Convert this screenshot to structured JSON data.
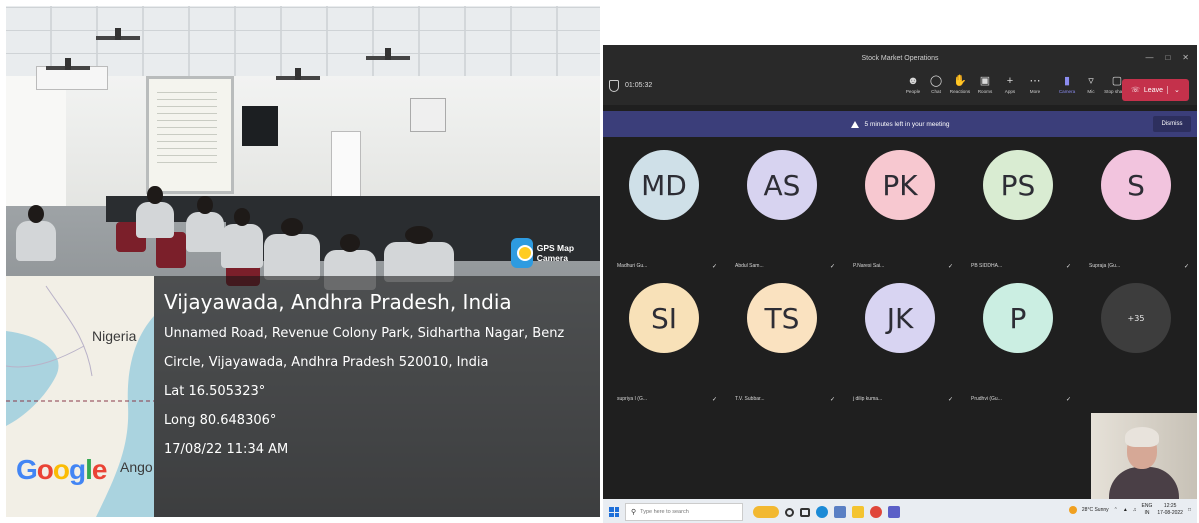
{
  "photo": {
    "gps_badge_label": "GPS Map Camera",
    "map": {
      "country_1": "Nigeria",
      "country_2": "Ango",
      "provider": "Google"
    },
    "location": {
      "city": "Vijayawada, Andhra Pradesh, India",
      "address_line_1": "Unnamed Road, Revenue Colony Park, Sidhartha Nagar, Benz",
      "address_line_2": "Circle, Vijayawada, Andhra Pradesh 520010, India",
      "lat": "Lat 16.505323°",
      "long": "Long 80.648306°",
      "timestamp": "17/08/22 11:34 AM"
    }
  },
  "teams": {
    "window_title": "Stock Market Operations",
    "timer": "01:05:32",
    "toolbar": [
      {
        "label": "People",
        "icon": "people-icon"
      },
      {
        "label": "Chat",
        "icon": "chat-icon"
      },
      {
        "label": "Reactions",
        "icon": "reactions-icon"
      },
      {
        "label": "Rooms",
        "icon": "rooms-icon"
      },
      {
        "label": "Apps",
        "icon": "apps-icon"
      },
      {
        "label": "More",
        "icon": "more-icon"
      },
      {
        "label": "Camera",
        "icon": "camera-icon"
      },
      {
        "label": "Mic",
        "icon": "mic-icon"
      },
      {
        "label": "Stop sharing",
        "icon": "share-icon"
      }
    ],
    "leave_label": "Leave",
    "banner": {
      "text": "5 minutes left in your meeting",
      "dismiss_label": "Dismiss"
    },
    "participants": [
      {
        "initials": "MD",
        "name": "Madhuri Gu...",
        "color": "#cfe0e8"
      },
      {
        "initials": "AS",
        "name": "Abdul Sam...",
        "color": "#d7d3f0"
      },
      {
        "initials": "PK",
        "name": "P.Naresi Sai...",
        "color": "#f7c8d0"
      },
      {
        "initials": "PS",
        "name": "PB SIDDHA...",
        "color": "#d9ecd2"
      },
      {
        "initials": "S",
        "name": "Supraja (Gu...",
        "color": "#f2c4de"
      },
      {
        "initials": "SI",
        "name": "supriya I (G...",
        "color": "#f8e1b8"
      },
      {
        "initials": "TS",
        "name": "T.V. Subbar...",
        "color": "#fae2c0"
      },
      {
        "initials": "JK",
        "name": "j dilip kuma...",
        "color": "#d8d4f2"
      },
      {
        "initials": "P",
        "name": "Prudhvi (Gu...",
        "color": "#cbeee2"
      }
    ],
    "overflow": "+35",
    "taskbar": {
      "search_placeholder": "Type here to search",
      "weather": "28°C Sunny",
      "lang": "ENG",
      "region": "IN",
      "time": "12:25",
      "date": "17-08-2022"
    }
  }
}
